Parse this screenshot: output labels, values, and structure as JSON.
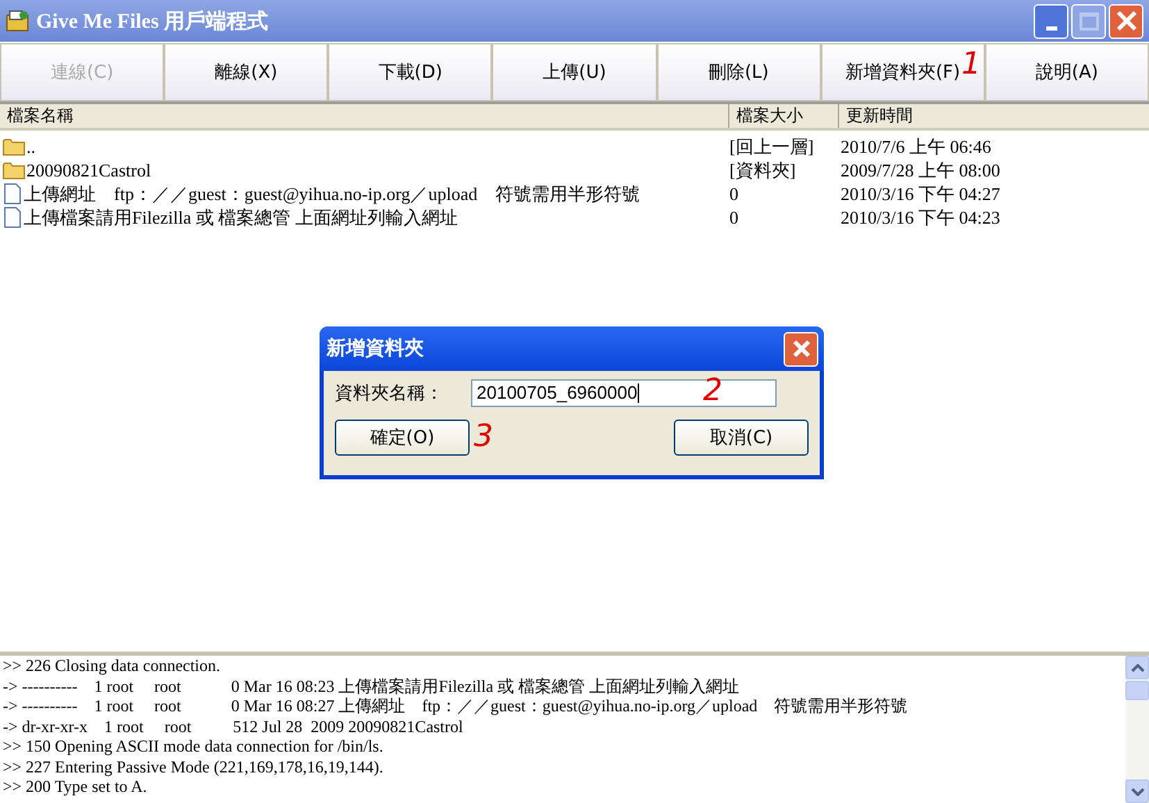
{
  "window": {
    "title": "Give Me Files 用戶端程式"
  },
  "toolbar": [
    {
      "label": "連線(C)",
      "disabled": true
    },
    {
      "label": "離線(X)",
      "disabled": false
    },
    {
      "label": "下載(D)",
      "disabled": false
    },
    {
      "label": "上傳(U)",
      "disabled": false
    },
    {
      "label": "刪除(L)",
      "disabled": false
    },
    {
      "label": "新增資料夾(F)",
      "disabled": false
    },
    {
      "label": "說明(A)",
      "disabled": false
    }
  ],
  "table": {
    "columns": [
      "檔案名稱",
      "檔案大小",
      "更新時間"
    ],
    "rows": [
      {
        "kind": "folder",
        "name": "..",
        "size": "[回上一層]",
        "time": "2010/7/6 上午 06:46"
      },
      {
        "kind": "folder",
        "name": "20090821Castrol",
        "size": "[資料夾]",
        "time": "2009/7/28 上午 08:00"
      },
      {
        "kind": "file",
        "name": "上傳網址　ftp：／／guest：guest@yihua.no-ip.org／upload　符號需用半形符號",
        "size": "0",
        "time": "2010/3/16 下午 04:27"
      },
      {
        "kind": "file",
        "name": "上傳檔案請用Filezilla 或 檔案總管 上面網址列輸入網址",
        "size": "0",
        "time": "2010/3/16 下午 04:23"
      }
    ]
  },
  "dialog": {
    "title": "新增資料夾",
    "field_label": "資料夾名稱：",
    "value": "20100705_6960000",
    "buttons": [
      "確定(O)",
      "取消(C)"
    ]
  },
  "annotations": [
    "1",
    "2",
    "3"
  ],
  "log": [
    ">> 226 Closing data connection.",
    "-> ----------    1 root     root            0 Mar 16 08:23 上傳檔案請用Filezilla 或 檔案總管 上面網址列輸入網址",
    "-> ----------    1 root     root            0 Mar 16 08:27 上傳網址　ftp：／／guest：guest@yihua.no-ip.org／upload　符號需用半形符號",
    "-> dr-xr-xr-x    1 root     root          512 Jul 28  2009 20090821Castrol",
    ">> 150 Opening ASCII mode data connection for /bin/ls.",
    ">> 227 Entering Passive Mode (221,169,178,16,19,144).",
    ">> 200 Type set to A."
  ]
}
